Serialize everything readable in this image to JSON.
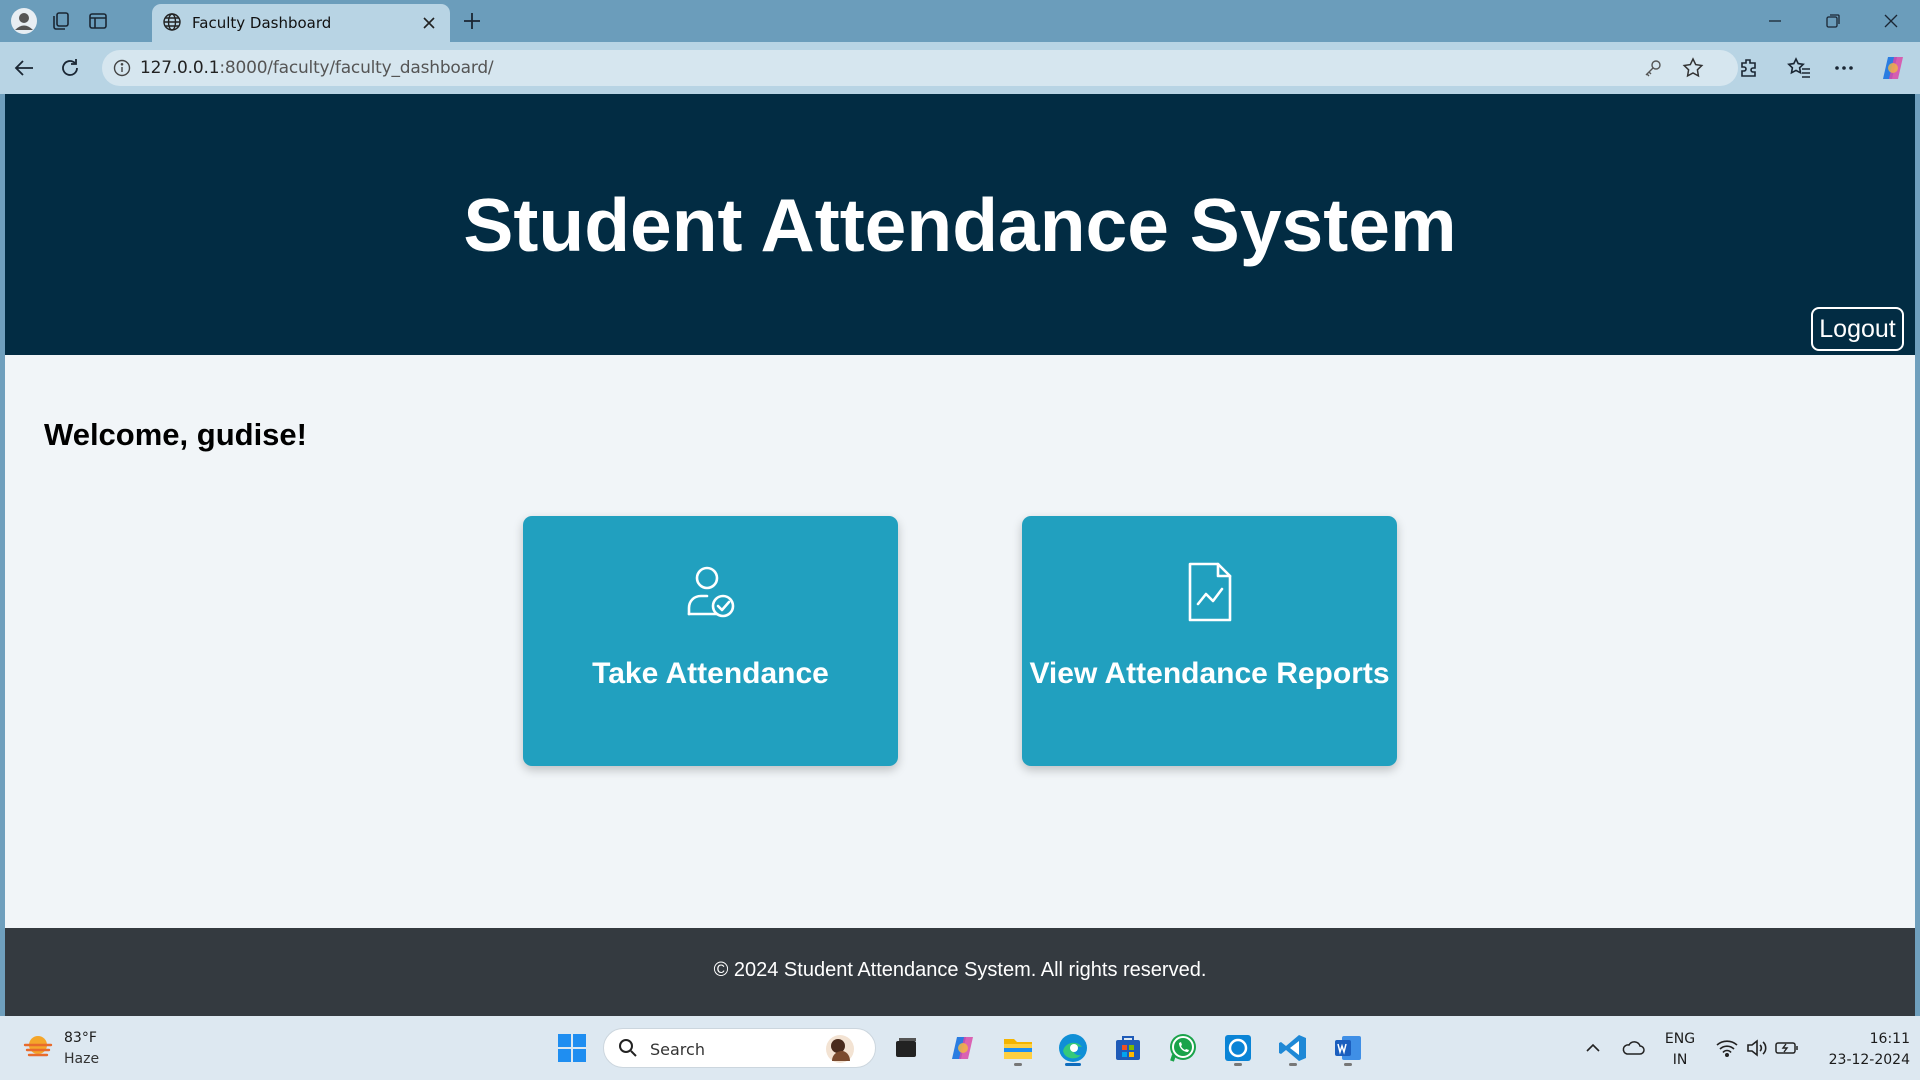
{
  "browser": {
    "tab_title": "Faculty Dashboard",
    "url_host": "127.0.0.1",
    "url_path": ":8000/faculty/faculty_dashboard/"
  },
  "page": {
    "header_title": "Student Attendance System",
    "logout_label": "Logout",
    "welcome": "Welcome, gudise!",
    "cards": [
      {
        "label": "Take Attendance",
        "icon": "user-check-icon"
      },
      {
        "label": "View Attendance Reports",
        "icon": "report-document-icon"
      }
    ],
    "footer": "© 2024 Student Attendance System. All rights reserved.",
    "colors": {
      "header": "#022c43",
      "card": "#21a0bf",
      "footer": "#343a40",
      "background": "#f1f5f8"
    }
  },
  "taskbar": {
    "weather_temp": "83°F",
    "weather_condition": "Haze",
    "search_placeholder": "Search",
    "lang_top": "ENG",
    "lang_bottom": "IN",
    "time": "16:11",
    "date": "23-12-2024"
  }
}
